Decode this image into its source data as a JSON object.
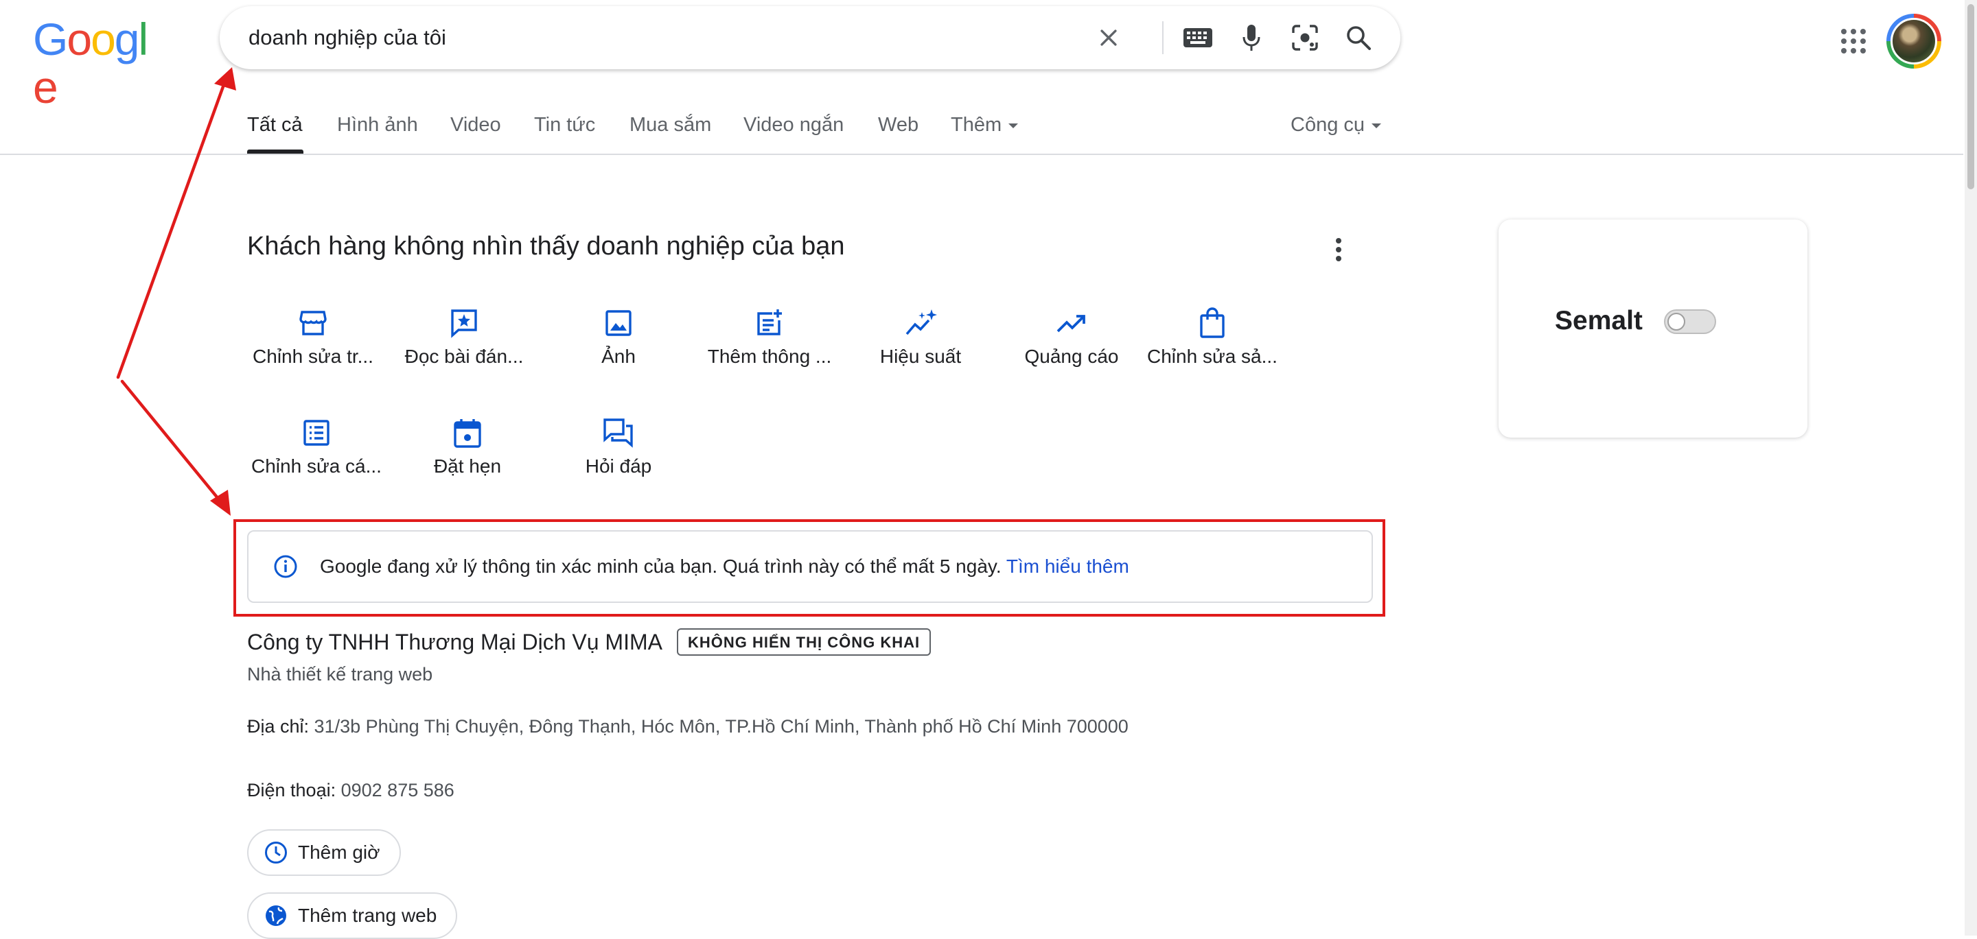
{
  "logo": {
    "letters": [
      {
        "ch": "G",
        "color": "#4285F4"
      },
      {
        "ch": "o",
        "color": "#EA4335"
      },
      {
        "ch": "o",
        "color": "#FBBC05"
      },
      {
        "ch": "g",
        "color": "#4285F4"
      },
      {
        "ch": "l",
        "color": "#34A853"
      },
      {
        "ch": "e",
        "color": "#EA4335"
      }
    ]
  },
  "search": {
    "query": "doanh nghiệp của tôi",
    "icons": [
      "close-icon",
      "keyboard-icon",
      "microphone-icon",
      "lens-icon",
      "search-icon"
    ]
  },
  "header_right": {
    "icons": [
      "apps-grid-icon",
      "avatar"
    ]
  },
  "tabs": {
    "all": "Tất cả",
    "images": "Hình ảnh",
    "video": "Video",
    "news": "Tin tức",
    "shopping": "Mua sắm",
    "short_videos": "Video ngắn",
    "web": "Web",
    "more": "Thêm",
    "tools": "Công cụ"
  },
  "business_card": {
    "title": "Khách hàng không nhìn thấy doanh nghiệp của bạn",
    "actions_row1": [
      {
        "label": "Chỉnh sửa tr...",
        "icon": "storefront-icon"
      },
      {
        "label": "Đọc bài đán...",
        "icon": "review-star-icon"
      },
      {
        "label": "Ảnh",
        "icon": "photo-icon"
      },
      {
        "label": "Thêm thông ...",
        "icon": "post-add-icon"
      },
      {
        "label": "Hiệu suất",
        "icon": "sparkle-performance-icon"
      },
      {
        "label": "Quảng cáo",
        "icon": "trending-up-icon"
      },
      {
        "label": "Chỉnh sửa sả...",
        "icon": "shopping-bag-icon"
      }
    ],
    "actions_row2": [
      {
        "label": "Chỉnh sửa cá...",
        "icon": "list-alt-icon"
      },
      {
        "label": "Đặt hẹn",
        "icon": "calendar-icon"
      },
      {
        "label": "Hỏi đáp",
        "icon": "forum-icon"
      }
    ]
  },
  "info_banner": {
    "text": "Google đang xử lý thông tin xác minh của bạn. Quá trình này có thể mất 5 ngày.",
    "link": "Tìm hiểu thêm"
  },
  "details": {
    "company_name": "Công ty TNHH Thương Mại Dịch Vụ MIMA",
    "badge": "KHÔNG HIỂN THỊ CÔNG KHAI",
    "category": "Nhà thiết kế trang web",
    "address_label": "Địa chỉ:",
    "address": "31/3b Phùng Thị Chuyện, Đông Thạnh, Hóc Môn, TP.Hồ Chí Minh, Thành phố Hồ Chí Minh 700000",
    "phone_label": "Điện thoại:",
    "phone": "0902 875 586",
    "add_hours": "Thêm giờ",
    "add_website": "Thêm trang web"
  },
  "side_card": {
    "label": "Semalt",
    "toggle_on": false
  },
  "colors": {
    "accent_blue": "#0b57d0",
    "annotation_red": "#e01b1b",
    "link_blue": "#1a4fd1"
  }
}
